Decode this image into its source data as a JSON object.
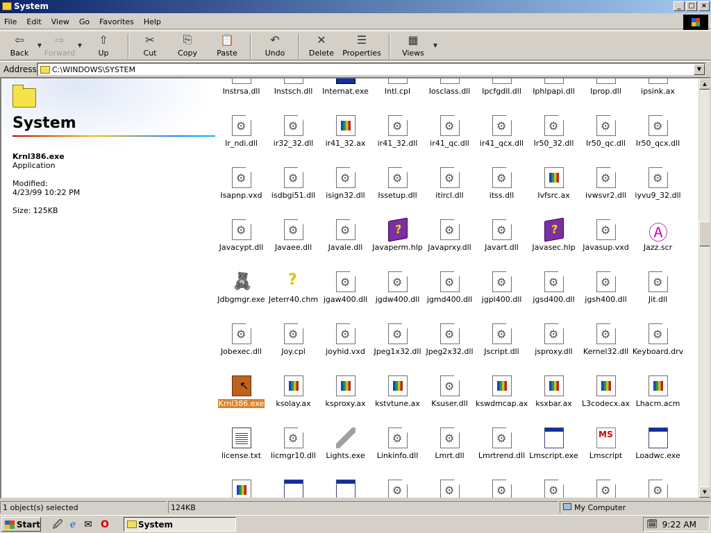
{
  "window": {
    "title": "System"
  },
  "menu": [
    "File",
    "Edit",
    "View",
    "Go",
    "Favorites",
    "Help"
  ],
  "toolbar": [
    {
      "label": "Back",
      "icon": "back-arrow-icon",
      "glyph": "⇦",
      "enabled": true,
      "dropdown": true
    },
    {
      "label": "Forward",
      "icon": "forward-arrow-icon",
      "glyph": "⇨",
      "enabled": false,
      "dropdown": true
    },
    {
      "label": "Up",
      "icon": "up-folder-icon",
      "glyph": "⇧",
      "enabled": true
    },
    {
      "label": "Cut",
      "icon": "scissors-icon",
      "glyph": "✂",
      "enabled": true
    },
    {
      "label": "Copy",
      "icon": "copy-icon",
      "glyph": "⎘",
      "enabled": true
    },
    {
      "label": "Paste",
      "icon": "paste-icon",
      "glyph": "📋",
      "enabled": true
    },
    {
      "label": "Undo",
      "icon": "undo-icon",
      "glyph": "↶",
      "enabled": true
    },
    {
      "label": "Delete",
      "icon": "delete-x-icon",
      "glyph": "✕",
      "enabled": true
    },
    {
      "label": "Properties",
      "icon": "properties-icon",
      "glyph": "☰",
      "enabled": true
    },
    {
      "label": "Views",
      "icon": "views-icon",
      "glyph": "▦",
      "enabled": true,
      "dropdown": true
    }
  ],
  "address": {
    "label": "Address",
    "value": "C:\\WINDOWS\\SYSTEM"
  },
  "left_pane": {
    "title": "System",
    "selected": {
      "name": "Krnl386.exe",
      "type": "Application",
      "modified_label": "Modified:",
      "modified": "4/23/99 10:22 PM",
      "size": "Size: 125KB"
    }
  },
  "files": [
    [
      {
        "n": "Instrsa.dll",
        "t": "dll"
      },
      {
        "n": "Instsch.dll",
        "t": "dll"
      },
      {
        "n": "Internat.exe",
        "t": "gen"
      },
      {
        "n": "Intl.cpl",
        "t": "dll"
      },
      {
        "n": "Iosclass.dll",
        "t": "dll"
      },
      {
        "n": "Ipcfgdll.dll",
        "t": "dll"
      },
      {
        "n": "Iphlpapi.dll",
        "t": "dll"
      },
      {
        "n": "Iprop.dll",
        "t": "dll"
      },
      {
        "n": "ipsink.ax",
        "t": "ax"
      }
    ],
    [
      {
        "n": "Ir_ndi.dll",
        "t": "dll"
      },
      {
        "n": "ir32_32.dll",
        "t": "dll"
      },
      {
        "n": "ir41_32.ax",
        "t": "ax"
      },
      {
        "n": "ir41_32.dll",
        "t": "dll"
      },
      {
        "n": "ir41_qc.dll",
        "t": "dll"
      },
      {
        "n": "ir41_qcx.dll",
        "t": "dll"
      },
      {
        "n": "Ir50_32.dll",
        "t": "dll"
      },
      {
        "n": "Ir50_qc.dll",
        "t": "dll"
      },
      {
        "n": "Ir50_qcx.dll",
        "t": "dll"
      }
    ],
    [
      {
        "n": "Isapnp.vxd",
        "t": "dll"
      },
      {
        "n": "isdbgi51.dll",
        "t": "dll"
      },
      {
        "n": "isign32.dll",
        "t": "dll"
      },
      {
        "n": "Issetup.dll",
        "t": "dll"
      },
      {
        "n": "itircl.dll",
        "t": "dll"
      },
      {
        "n": "itss.dll",
        "t": "dll"
      },
      {
        "n": "Ivfsrc.ax",
        "t": "ax"
      },
      {
        "n": "ivwsvr2.dll",
        "t": "dll"
      },
      {
        "n": "iyvu9_32.dll",
        "t": "dll"
      }
    ],
    [
      {
        "n": "Javacypt.dll",
        "t": "dll"
      },
      {
        "n": "Javaee.dll",
        "t": "dll"
      },
      {
        "n": "Javale.dll",
        "t": "dll"
      },
      {
        "n": "Javaperm.hlp",
        "t": "hlp"
      },
      {
        "n": "Javaprxy.dll",
        "t": "dll"
      },
      {
        "n": "Javart.dll",
        "t": "dll"
      },
      {
        "n": "Javasec.hlp",
        "t": "hlp"
      },
      {
        "n": "Javasup.vxd",
        "t": "dll"
      },
      {
        "n": "Jazz.scr",
        "t": "scr"
      }
    ],
    [
      {
        "n": "Jdbgmgr.exe",
        "t": "bear"
      },
      {
        "n": "Jeterr40.chm",
        "t": "chm"
      },
      {
        "n": "jgaw400.dll",
        "t": "dll"
      },
      {
        "n": "jgdw400.dll",
        "t": "dll"
      },
      {
        "n": "jgmd400.dll",
        "t": "dll"
      },
      {
        "n": "jgpl400.dll",
        "t": "dll"
      },
      {
        "n": "jgsd400.dll",
        "t": "dll"
      },
      {
        "n": "jgsh400.dll",
        "t": "dll"
      },
      {
        "n": "Jit.dll",
        "t": "dll"
      }
    ],
    [
      {
        "n": "Jobexec.dll",
        "t": "dll"
      },
      {
        "n": "Joy.cpl",
        "t": "dll"
      },
      {
        "n": "joyhid.vxd",
        "t": "dll"
      },
      {
        "n": "Jpeg1x32.dll",
        "t": "dll"
      },
      {
        "n": "Jpeg2x32.dll",
        "t": "dll"
      },
      {
        "n": "Jscript.dll",
        "t": "dll"
      },
      {
        "n": "jsproxy.dll",
        "t": "dll"
      },
      {
        "n": "Kernel32.dll",
        "t": "dll"
      },
      {
        "n": "Keyboard.drv",
        "t": "dll"
      }
    ],
    [
      {
        "n": "Krnl386.exe",
        "t": "kern",
        "selected": true
      },
      {
        "n": "ksolay.ax",
        "t": "ax"
      },
      {
        "n": "ksproxy.ax",
        "t": "ax"
      },
      {
        "n": "kstvtune.ax",
        "t": "ax"
      },
      {
        "n": "Ksuser.dll",
        "t": "dll"
      },
      {
        "n": "kswdmcap.ax",
        "t": "ax"
      },
      {
        "n": "ksxbar.ax",
        "t": "ax"
      },
      {
        "n": "L3codecx.ax",
        "t": "ax"
      },
      {
        "n": "Lhacm.acm",
        "t": "ax"
      }
    ],
    [
      {
        "n": "license.txt",
        "t": "txt"
      },
      {
        "n": "licmgr10.dll",
        "t": "dll"
      },
      {
        "n": "Lights.exe",
        "t": "lights"
      },
      {
        "n": "Linkinfo.dll",
        "t": "dll"
      },
      {
        "n": "Lmrt.dll",
        "t": "dll"
      },
      {
        "n": "Lmrtrend.dll",
        "t": "dll"
      },
      {
        "n": "Lmscript.exe",
        "t": "exe"
      },
      {
        "n": "Lmscript",
        "t": "ms"
      },
      {
        "n": "Loadwc.exe",
        "t": "exe"
      }
    ],
    [
      {
        "n": "",
        "t": "ax"
      },
      {
        "n": "",
        "t": "exe"
      },
      {
        "n": "",
        "t": "exe"
      },
      {
        "n": "",
        "t": "dll"
      },
      {
        "n": "",
        "t": "dll"
      },
      {
        "n": "",
        "t": "dll"
      },
      {
        "n": "",
        "t": "dll"
      },
      {
        "n": "",
        "t": "dll"
      },
      {
        "n": "",
        "t": "dll"
      }
    ]
  ],
  "status": {
    "selection": "1 object(s) selected",
    "size": "124KB",
    "zone": "My Computer"
  },
  "taskbar": {
    "start": "Start",
    "task": "System",
    "clock": "9:22 AM"
  }
}
